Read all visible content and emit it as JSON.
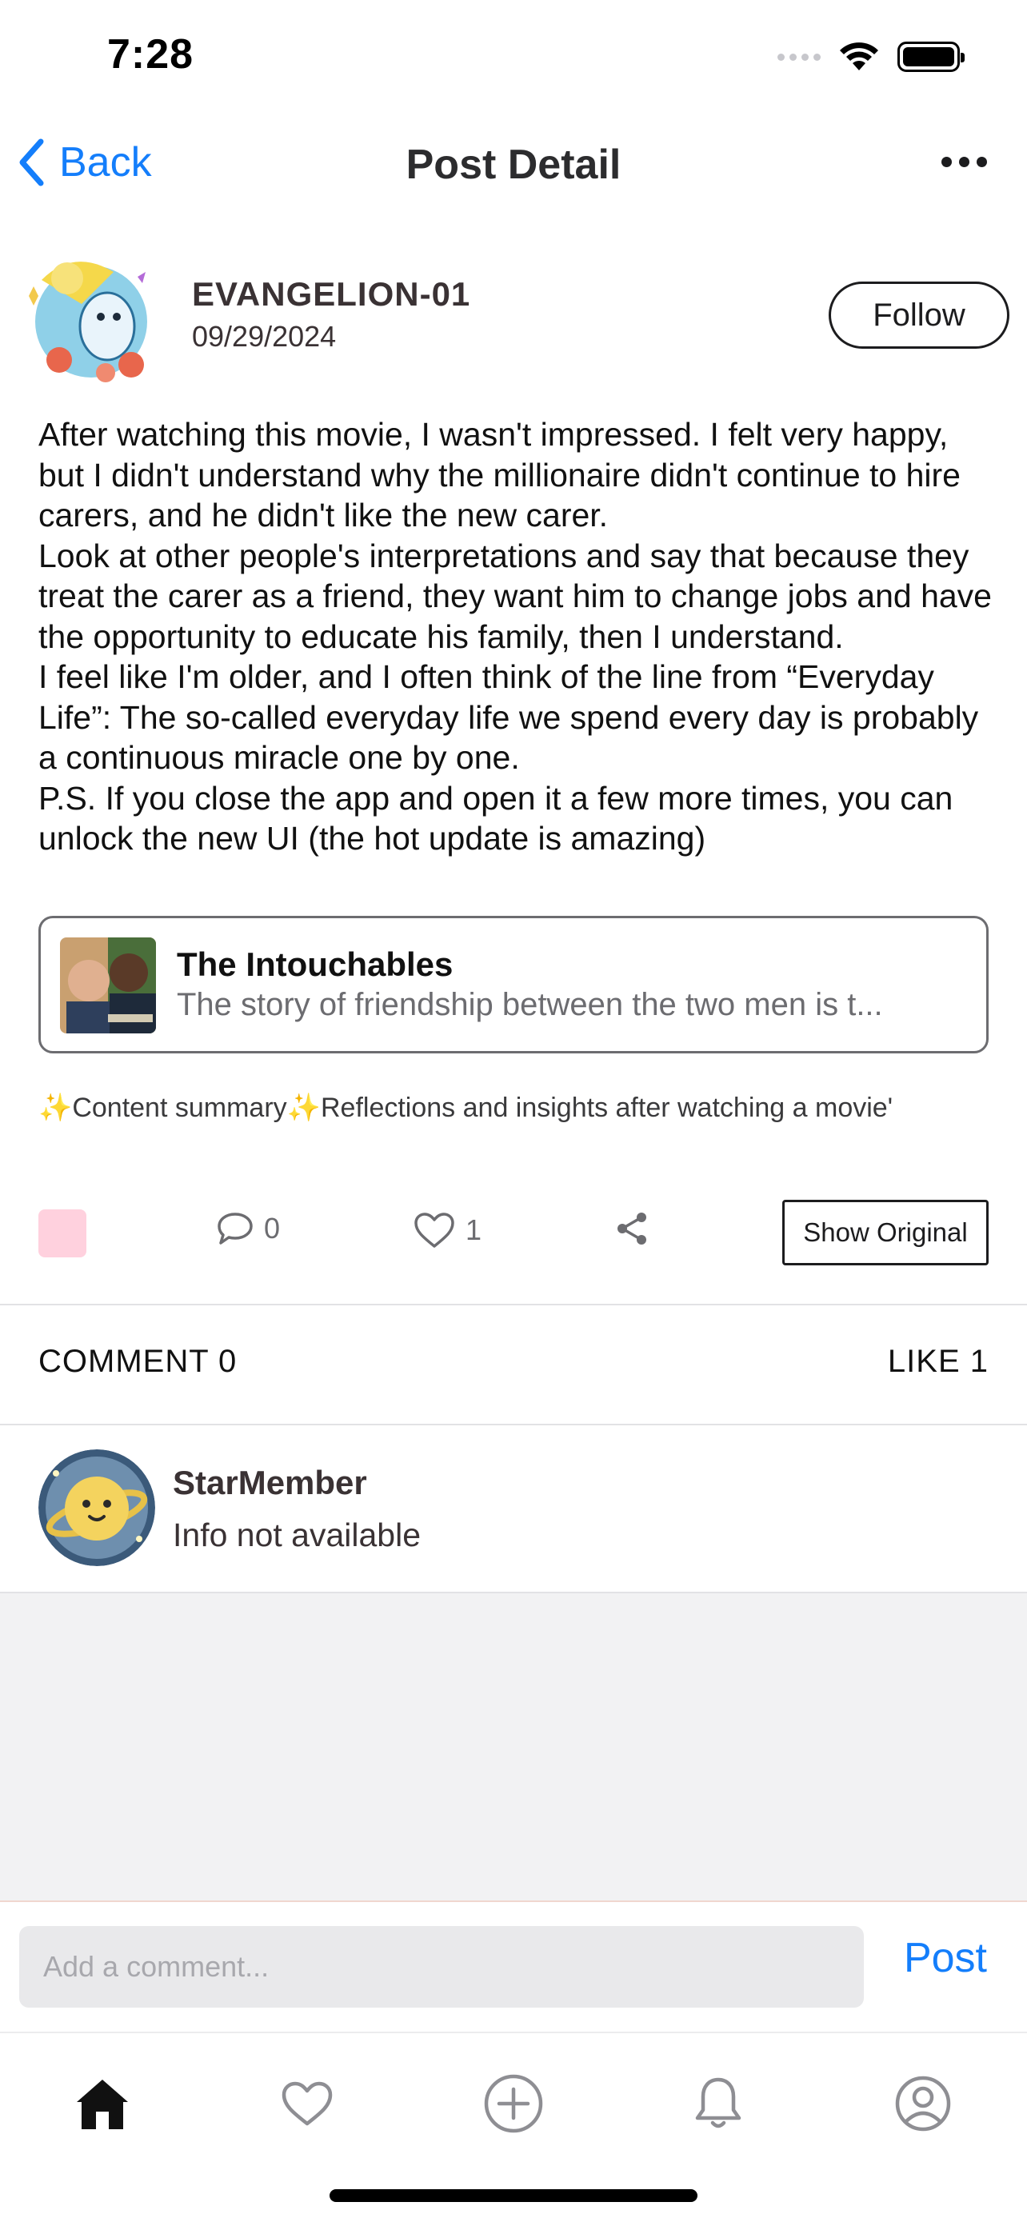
{
  "status_bar": {
    "time": "7:28"
  },
  "nav": {
    "back_label": "Back",
    "title": "Post Detail"
  },
  "author": {
    "name": "EVANGELION-01",
    "date": "09/29/2024",
    "follow_label": "Follow"
  },
  "post": {
    "paragraphs": [
      "After watching this movie, I wasn't impressed. I felt very happy, but I didn't understand why the millionaire didn't continue to hire carers, and he didn't like the new carer.",
      "Look at other people's interpretations and say that because they treat the carer as a friend, they want him to change jobs and have the opportunity to educate his family, then I understand.",
      "I feel like I'm older, and I often think of the line from “Everyday Life”: The so-called everyday life we spend every day is probably a continuous miracle one by one.",
      "P.S. If you close the app and open it a few more times, you can unlock the new UI (the hot update is amazing)"
    ]
  },
  "movie": {
    "title": "The Intouchables",
    "description": "The story of friendship between the two men is t..."
  },
  "summary": "✨Content summary✨Reflections and insights after watching a movie'",
  "actions": {
    "comment_count": "0",
    "like_count": "1",
    "show_original_label": "Show Original"
  },
  "tabs": {
    "comment_label": "COMMENT 0",
    "like_label": "LIKE 1"
  },
  "liker": {
    "name": "StarMember",
    "info": "Info not available"
  },
  "comment_bar": {
    "placeholder": "Add a comment...",
    "post_label": "Post"
  },
  "tab_bar": {
    "items": [
      "home-icon",
      "heart-icon",
      "plus-circle-icon",
      "bell-icon",
      "profile-icon"
    ]
  },
  "colors": {
    "accent": "#147efb",
    "pink_chip": "#ffd1de",
    "text": "#111111"
  }
}
